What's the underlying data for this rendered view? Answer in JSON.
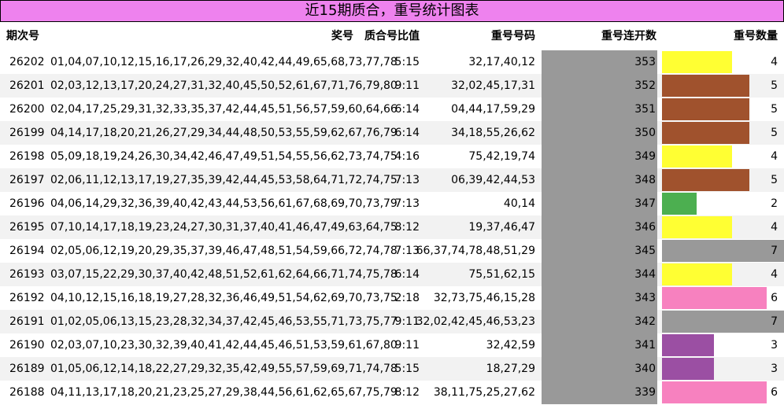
{
  "title": "近15期质合，重号统计图表",
  "headers": {
    "period": "期次号",
    "numbers": "奖号",
    "ratio": "质合号比值",
    "repeat": "重号号码",
    "run": "重号连开数",
    "count": "重号数量"
  },
  "chart_data": {
    "type": "table",
    "count_max": 7,
    "count_colors": {
      "2": "#4caf50",
      "3": "#9b4fa3",
      "4": "#ffff33",
      "5": "#a0522d",
      "6": "#f781bf",
      "7": "#999999"
    },
    "rows": [
      {
        "period": "26202",
        "numbers": "01,04,07,10,12,15,16,17,26,29,32,40,42,44,49,65,68,73,77,78",
        "ratio": "5:15",
        "repeat": "32,17,40,12",
        "run": "353",
        "count": 4
      },
      {
        "period": "26201",
        "numbers": "02,03,12,13,17,20,24,27,31,32,40,45,50,52,61,67,71,76,79,80",
        "ratio": "9:11",
        "repeat": "32,02,45,17,31",
        "run": "352",
        "count": 5
      },
      {
        "period": "26200",
        "numbers": "02,04,17,25,29,31,32,33,35,37,42,44,45,51,56,57,59,60,64,66",
        "ratio": "6:14",
        "repeat": "04,44,17,59,29",
        "run": "351",
        "count": 5
      },
      {
        "period": "26199",
        "numbers": "04,14,17,18,20,21,26,27,29,34,44,48,50,53,55,59,62,67,76,79",
        "ratio": "6:14",
        "repeat": "34,18,55,26,62",
        "run": "350",
        "count": 5
      },
      {
        "period": "26198",
        "numbers": "05,09,18,19,24,26,30,34,42,46,47,49,51,54,55,56,62,73,74,75",
        "ratio": "4:16",
        "repeat": "75,42,19,74",
        "run": "349",
        "count": 4
      },
      {
        "period": "26197",
        "numbers": "02,06,11,12,13,17,19,27,35,39,42,44,45,53,58,64,71,72,74,75",
        "ratio": "7:13",
        "repeat": "06,39,42,44,53",
        "run": "348",
        "count": 5
      },
      {
        "period": "26196",
        "numbers": "04,06,14,29,32,36,39,40,42,43,44,53,56,61,67,68,69,70,73,79",
        "ratio": "7:13",
        "repeat": "40,14",
        "run": "347",
        "count": 2
      },
      {
        "period": "26195",
        "numbers": "07,10,14,17,18,19,23,24,27,30,31,37,40,41,46,47,49,63,64,75",
        "ratio": "8:12",
        "repeat": "19,37,46,47",
        "run": "346",
        "count": 4
      },
      {
        "period": "26194",
        "numbers": "02,05,06,12,19,20,29,35,37,39,46,47,48,51,54,59,66,72,74,78",
        "ratio": "7:13",
        "repeat": "66,37,74,78,48,51,29",
        "run": "345",
        "count": 7
      },
      {
        "period": "26193",
        "numbers": "03,07,15,22,29,30,37,40,42,48,51,52,61,62,64,66,71,74,75,78",
        "ratio": "6:14",
        "repeat": "75,51,62,15",
        "run": "344",
        "count": 4
      },
      {
        "period": "26192",
        "numbers": "04,10,12,15,16,18,19,27,28,32,36,46,49,51,54,62,69,70,73,75",
        "ratio": "2:18",
        "repeat": "32,73,75,46,15,28",
        "run": "343",
        "count": 6
      },
      {
        "period": "26191",
        "numbers": "01,02,05,06,13,15,23,28,32,34,37,42,45,46,53,55,71,73,75,77",
        "ratio": "9:11",
        "repeat": "32,02,42,45,46,53,23",
        "run": "342",
        "count": 7
      },
      {
        "period": "26190",
        "numbers": "02,03,07,10,23,30,32,39,40,41,42,44,45,46,51,53,59,61,67,80",
        "ratio": "9:11",
        "repeat": "32,42,59",
        "run": "341",
        "count": 3
      },
      {
        "period": "26189",
        "numbers": "01,05,06,12,14,18,22,27,29,32,35,42,49,55,57,59,69,71,74,78",
        "ratio": "5:15",
        "repeat": "18,27,29",
        "run": "340",
        "count": 3
      },
      {
        "period": "26188",
        "numbers": "04,11,13,17,18,20,21,23,25,27,29,38,44,56,61,62,65,67,75,79",
        "ratio": "8:12",
        "repeat": "38,11,75,25,27,62",
        "run": "339",
        "count": 6
      }
    ]
  }
}
